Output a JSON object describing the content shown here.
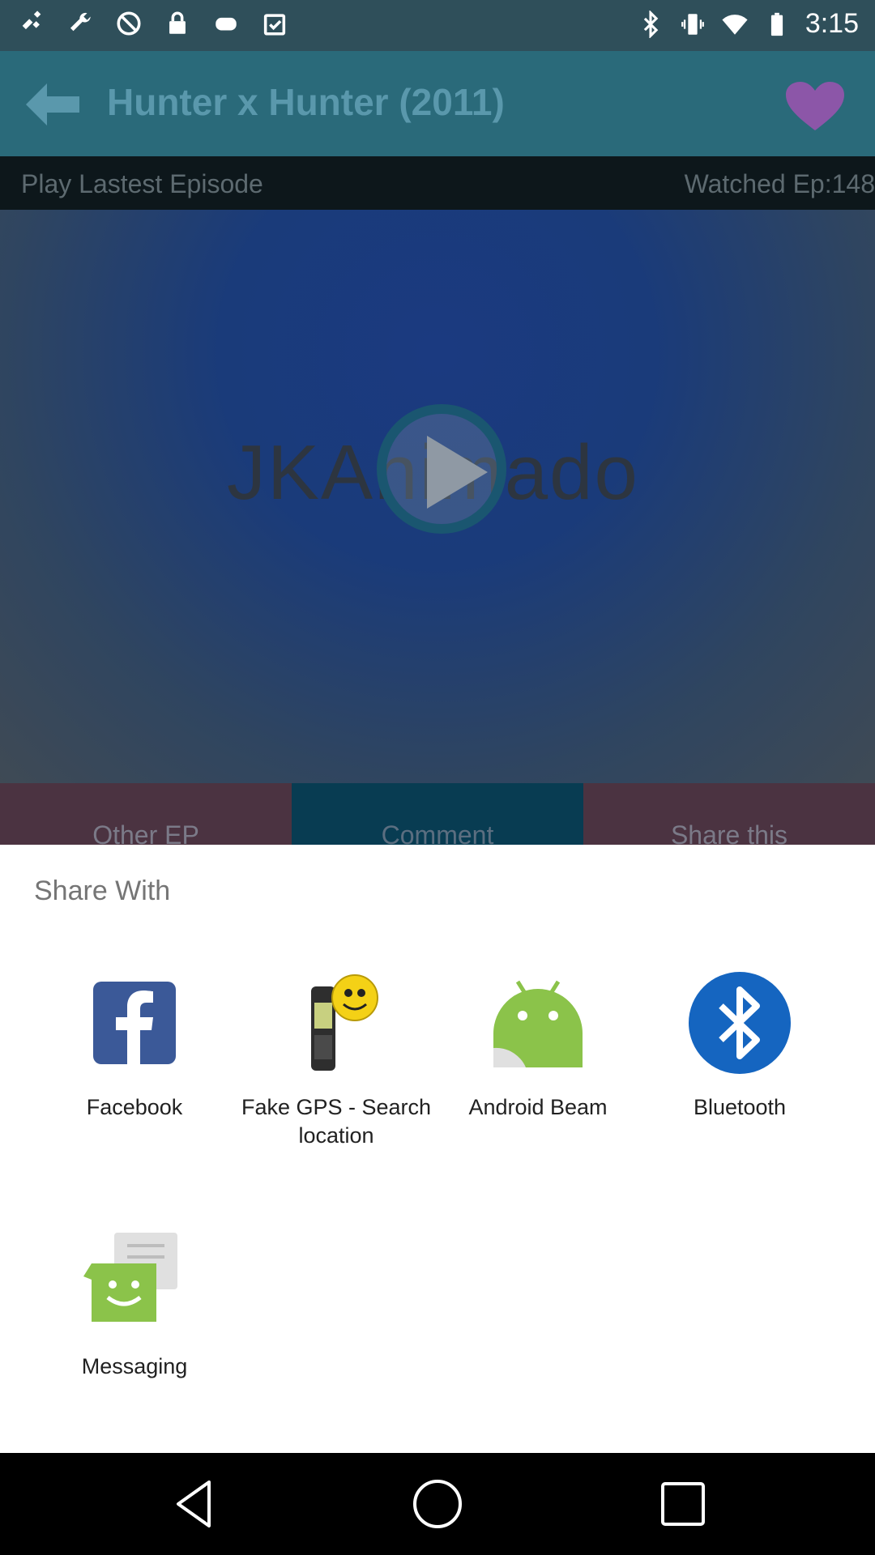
{
  "status_bar": {
    "time": "3:15",
    "left_icons": [
      "satellite-icon",
      "wrench-icon",
      "block-icon",
      "lock-icon",
      "game-icon",
      "clipboard-icon"
    ],
    "right_icons": [
      "bluetooth-icon",
      "vibrate-icon",
      "wifi-icon",
      "battery-icon"
    ]
  },
  "app_bar": {
    "title": "Hunter x Hunter (2011)",
    "back_icon": "back-arrow-icon",
    "favorite_icon": "heart-icon"
  },
  "episode_bar": {
    "play_label": "Play Lastest Episode",
    "watched_label": "Watched Ep:148"
  },
  "video": {
    "watermark": "JKAnimado",
    "play_icon": "play-icon"
  },
  "tabs": [
    {
      "label": "Other EP"
    },
    {
      "label": "Comment"
    },
    {
      "label": "Share this"
    }
  ],
  "share_sheet": {
    "title": "Share With",
    "apps": [
      {
        "label": "Facebook",
        "icon": "facebook-icon"
      },
      {
        "label": "Fake GPS - Search location",
        "icon": "gps-icon"
      },
      {
        "label": "Android Beam",
        "icon": "android-icon"
      },
      {
        "label": "Bluetooth",
        "icon": "bluetooth-icon"
      },
      {
        "label": "Messaging",
        "icon": "messaging-icon"
      }
    ]
  },
  "nav_bar": {
    "icons": [
      "back-triangle-icon",
      "home-circle-icon",
      "recents-square-icon"
    ]
  }
}
